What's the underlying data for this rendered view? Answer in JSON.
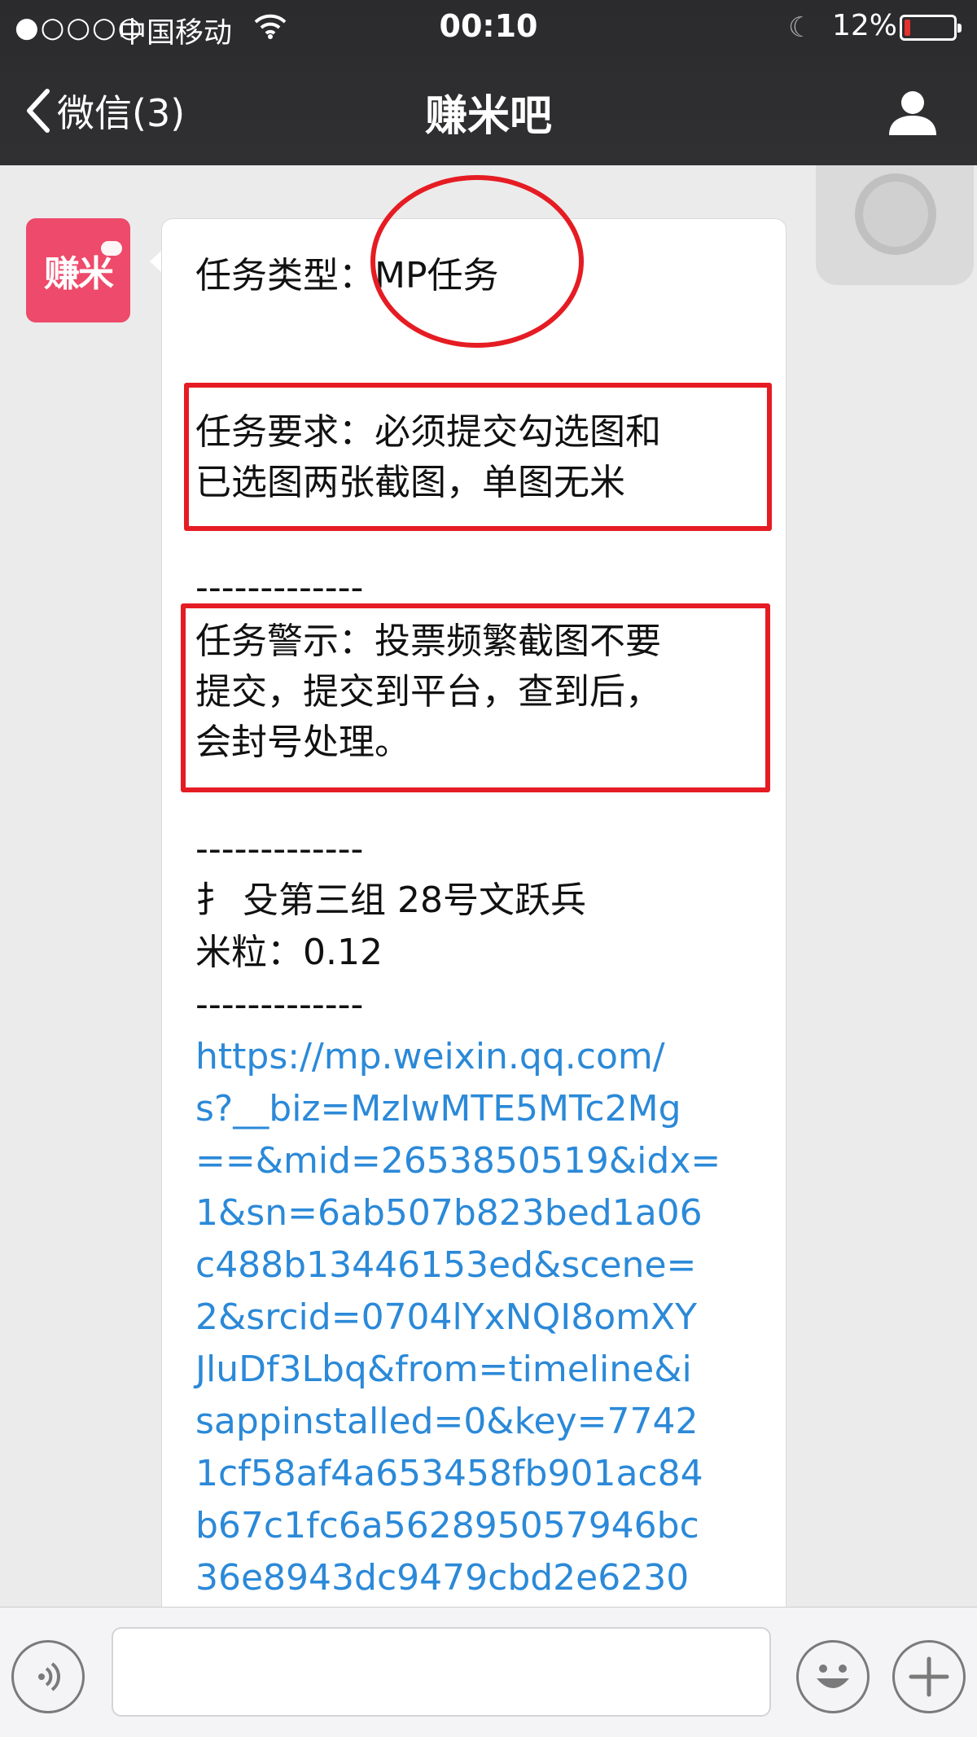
{
  "status_bar": {
    "signal": "●○○○○",
    "carrier": "中国移动",
    "time": "00:10",
    "battery_percent": "12%",
    "battery_level": 0.12,
    "battery_color": "#e53030"
  },
  "nav": {
    "back_label": "微信(3)",
    "title": "赚米吧",
    "back_icon": "chevron-left-icon",
    "profile_icon": "person-icon"
  },
  "sender": {
    "avatar_text": "赚米",
    "avatar_color": "#ee4a6b"
  },
  "message": {
    "lines": [
      "任务类型：MP任务",
      "--------------",
      "任务要求：必须提交勾选图和",
      "已选图两张截图，单图无米",
      "-------------",
      "任务警示：投票频繁截图不要",
      "提交，提交到平台，查到后，",
      "会封号处理。",
      "-------------",
      "扌  殳第三组 28号文跃兵",
      "米粒：0.12",
      "-------------"
    ],
    "link_lines": [
      "https://mp.weixin.qq.com/",
      "s?__biz=MzIwMTE5MTc2Mg",
      "==&mid=2653850519&idx=",
      "1&sn=6ab507b823bed1a06",
      "c488b13446153ed&scene=",
      "2&srcid=0704lYxNQI8omXY",
      "JluDf3Lbq&from=timeline&i",
      "sappinstalled=0&key=7742",
      "1cf58af4a653458fb901ac84",
      "b67c1fc6a562895057946bc",
      "36e8943dc9479cbd2e6230"
    ],
    "link_color": "#2b89d8",
    "annotation_color": "#e51c23"
  },
  "input_bar": {
    "voice_icon": "voice-icon",
    "emoji_icon": "emoji-icon",
    "plus_icon": "plus-icon",
    "input_value": ""
  }
}
